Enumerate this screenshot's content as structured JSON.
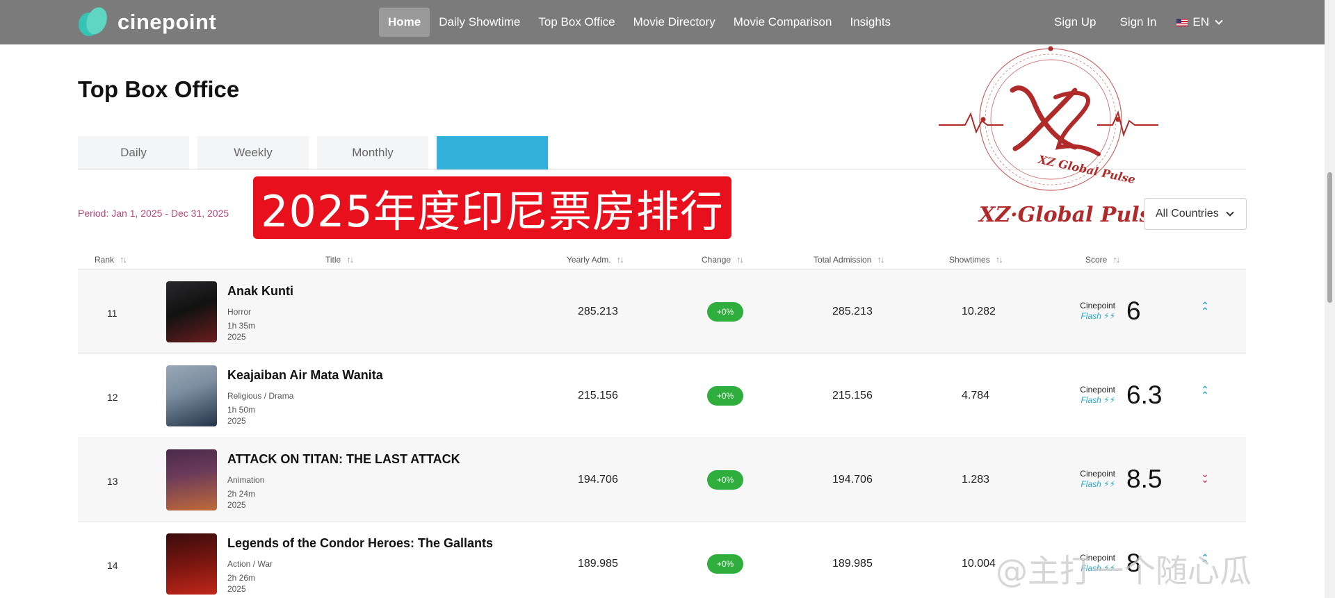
{
  "brand": {
    "name": "cinepoint"
  },
  "nav": {
    "items": [
      {
        "label": "Home",
        "active": true
      },
      {
        "label": "Daily Showtime",
        "active": false
      },
      {
        "label": "Top Box Office",
        "active": false
      },
      {
        "label": "Movie Directory",
        "active": false
      },
      {
        "label": "Movie Comparison",
        "active": false
      },
      {
        "label": "Insights",
        "active": false
      }
    ],
    "sign_up": "Sign Up",
    "sign_in": "Sign In",
    "language": "EN"
  },
  "page": {
    "title": "Top Box Office",
    "tabs": [
      {
        "label": "Daily",
        "active": false
      },
      {
        "label": "Weekly",
        "active": false
      },
      {
        "label": "Monthly",
        "active": false
      },
      {
        "label": "",
        "active": true
      }
    ],
    "period": "Period: Jan 1, 2025 - Dec 31, 2025",
    "country_select": "All Countries"
  },
  "overlay": {
    "banner": "2025年度印尼票房排行",
    "watermark_logo": "XZ Global Pulse",
    "watermark_caption": "XZ·Global Pulse",
    "weibo_watermark": "@主打一个随心瓜"
  },
  "table": {
    "columns": {
      "rank": "Rank",
      "title": "Title",
      "yearly": "Yearly Adm.",
      "change": "Change",
      "total": "Total Admission",
      "showtimes": "Showtimes",
      "score": "Score"
    },
    "score_source": {
      "name": "Cinepoint",
      "flash": "Flash ⚡⚡"
    },
    "rows": [
      {
        "rank": "11",
        "title": "Anak Kunti",
        "genre": "Horror",
        "duration": "1h 35m",
        "year": "2025",
        "yearly": "285.213",
        "change": "+0%",
        "total": "285.213",
        "showtimes": "10.282",
        "score": "6",
        "trend": "up",
        "trend_icon": "double-chevron-up-icon",
        "poster_colors": [
          "#2a2a2e",
          "#6b1e1e"
        ]
      },
      {
        "rank": "12",
        "title": "Keajaiban Air Mata Wanita",
        "genre": "Religious / Drama",
        "duration": "1h 50m",
        "year": "2025",
        "yearly": "215.156",
        "change": "+0%",
        "total": "215.156",
        "showtimes": "4.784",
        "score": "6.3",
        "trend": "up",
        "trend_icon": "double-chevron-up-icon",
        "poster_colors": [
          "#7c8ea0",
          "#23344a"
        ]
      },
      {
        "rank": "13",
        "title": "ATTACK ON TITAN: THE LAST ATTACK",
        "genre": "Animation",
        "duration": "2h 24m",
        "year": "2025",
        "yearly": "194.706",
        "change": "+0%",
        "total": "194.706",
        "showtimes": "1.283",
        "score": "8.5",
        "trend": "down",
        "trend_icon": "double-chevron-down-icon",
        "poster_colors": [
          "#6b3a5a",
          "#c06a3a"
        ]
      },
      {
        "rank": "14",
        "title": "Legends of the Condor Heroes: The Gallants",
        "genre": "Action / War",
        "duration": "2h 26m",
        "year": "2025",
        "yearly": "189.985",
        "change": "+0%",
        "total": "189.985",
        "showtimes": "10.004",
        "score": "8",
        "trend": "up",
        "trend_icon": "double-chevron-up-icon",
        "poster_colors": [
          "#3a0c0c",
          "#c0261a"
        ]
      }
    ]
  },
  "colors": {
    "nav_bg": "#7b7b7b",
    "active_tab": "#33b1da",
    "change_badge": "#2fae3e",
    "period_text": "#b0497a",
    "banner_red": "#e8101c",
    "watermark_red": "#b02a2a"
  }
}
